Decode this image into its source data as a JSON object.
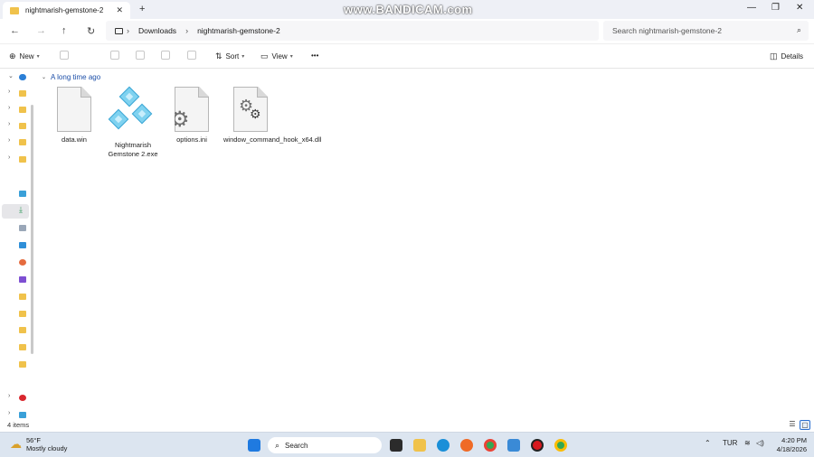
{
  "window": {
    "tab_title": "nightmarish-gemstone-2",
    "watermark": "www.BANDICAM.com",
    "controls": {
      "minimize": "—",
      "maximize": "❐",
      "close": "✕"
    }
  },
  "address": {
    "breadcrumbs": [
      "Downloads",
      "nightmarish-gemstone-2"
    ],
    "search_placeholder": "Search nightmarish-gemstone-2"
  },
  "toolbar": {
    "new_label": "New",
    "sort_label": "Sort",
    "view_label": "View",
    "more_label": "•••",
    "details_label": "Details"
  },
  "content": {
    "group_header": "A long time ago",
    "files": [
      {
        "name": "data.win",
        "icon": "blank-document-icon"
      },
      {
        "name": "Nightmarish Gemstone 2.exe",
        "icon": "gem-app-icon"
      },
      {
        "name": "options.ini",
        "icon": "settings-file-icon"
      },
      {
        "name": "window_command_hook_x64.dll",
        "icon": "dll-file-icon"
      }
    ]
  },
  "status": {
    "item_count": "4 items"
  },
  "taskbar": {
    "weather_temp": "56°F",
    "weather_desc": "Mostly cloudy",
    "search_label": "Search",
    "language": "TUR",
    "time": "4:20 PM",
    "date": "4/18/2026"
  }
}
